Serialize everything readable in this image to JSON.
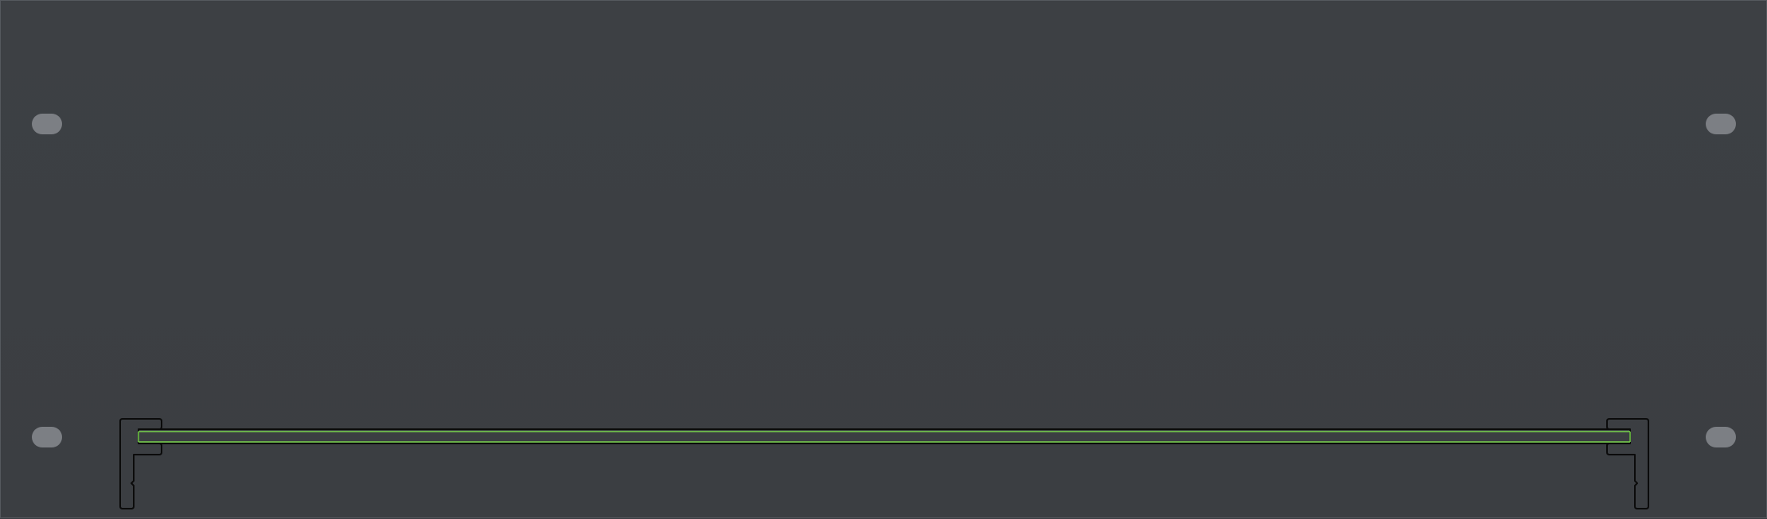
{
  "panel": {
    "background_color": "#3b3e42",
    "border_color": "#55595e",
    "mount_hole_color": "#7c7f84",
    "profile_stroke_color": "#0b0b0b",
    "channel_stroke_color": "#79d44d"
  },
  "elements": {
    "mount_holes": [
      "top-left",
      "top-right",
      "bottom-left",
      "bottom-right"
    ],
    "profile": "bracket-profile-with-rail",
    "channel": "green-rail-channel"
  }
}
